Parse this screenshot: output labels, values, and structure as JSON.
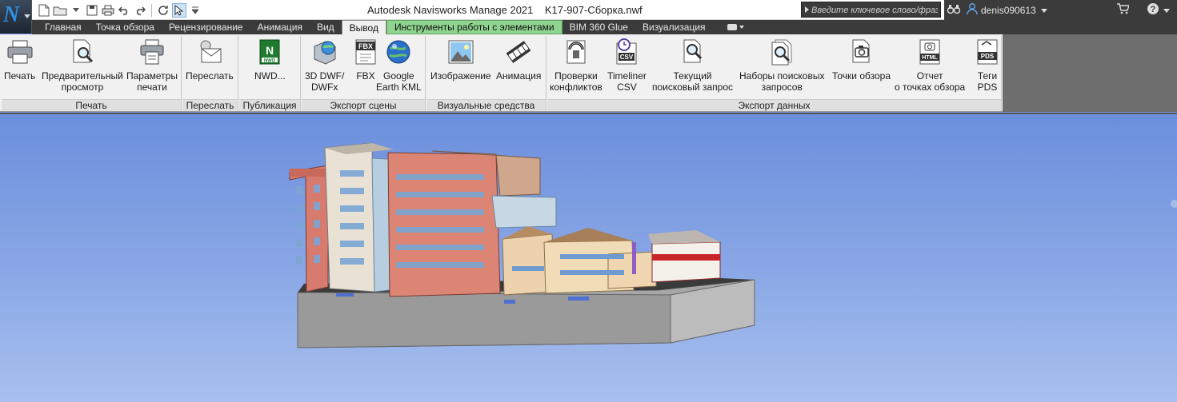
{
  "window": {
    "title": "Autodesk Navisworks Manage 2021    K17-907-Сборка.nwf",
    "app_button_letter": "N"
  },
  "search": {
    "placeholder": "Введите ключевое слово/фразу"
  },
  "user": {
    "name": "denis090613"
  },
  "tabs": [
    {
      "label": "Главная"
    },
    {
      "label": "Точка обзора"
    },
    {
      "label": "Рецензирование"
    },
    {
      "label": "Анимация"
    },
    {
      "label": "Вид"
    },
    {
      "label": "Вывод",
      "active": true
    },
    {
      "label": "Инструменты работы с элементами",
      "contextual": true
    },
    {
      "label": "BIM 360 Glue"
    },
    {
      "label": "Визуализация"
    }
  ],
  "panels": {
    "print": {
      "label": "Печать",
      "buttons": [
        "Печать",
        "Предварительный\nпросмотр",
        "Параметры\nпечати"
      ]
    },
    "send": {
      "label": "Переслать",
      "buttons": [
        "Переслать"
      ]
    },
    "publish": {
      "label": "Публикация",
      "buttons": [
        "NWD..."
      ]
    },
    "export_scene": {
      "label": "Экспорт сцены",
      "buttons": [
        "3D DWF/\nDWFx",
        "FBX",
        "Google\nEarth KML"
      ]
    },
    "visuals": {
      "label": "Визуальные средства",
      "buttons": [
        "Изображение",
        "Анимация"
      ]
    },
    "export_data": {
      "label": "Экспорт данных",
      "buttons": [
        "Проверки\nконфликтов",
        "Timeliner\nCSV",
        "Текущий\nпоисковый запрос",
        "Наборы поисковых\nзапросов",
        "Точки обзора",
        "Отчет\nо точках обзора",
        "Теги\nPDS"
      ]
    }
  },
  "icon_badges": {
    "nwd": "NWD",
    "fbx": "FBX",
    "csv": "CSV",
    "html": "HTML",
    "pds": "PDS"
  },
  "colors": {
    "accent_blue": "#2f8fe0",
    "contextual_tab": "#8fd48f",
    "viewport_sky": "#7c9ce2"
  }
}
